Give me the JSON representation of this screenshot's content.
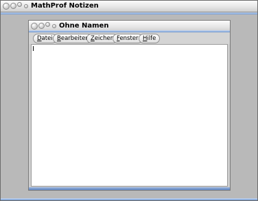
{
  "app_window": {
    "title": "MathProf Notizen"
  },
  "document_window": {
    "title": "Ohne Namen"
  },
  "menu": {
    "items": [
      {
        "mnemonic": "D",
        "rest": "atei"
      },
      {
        "mnemonic": "B",
        "rest": "earbeiten"
      },
      {
        "mnemonic": "Z",
        "rest": "eichen"
      },
      {
        "mnemonic": "F",
        "rest": "enster"
      },
      {
        "mnemonic": "H",
        "rest": "ilfe"
      }
    ]
  },
  "editor": {
    "content": ""
  }
}
